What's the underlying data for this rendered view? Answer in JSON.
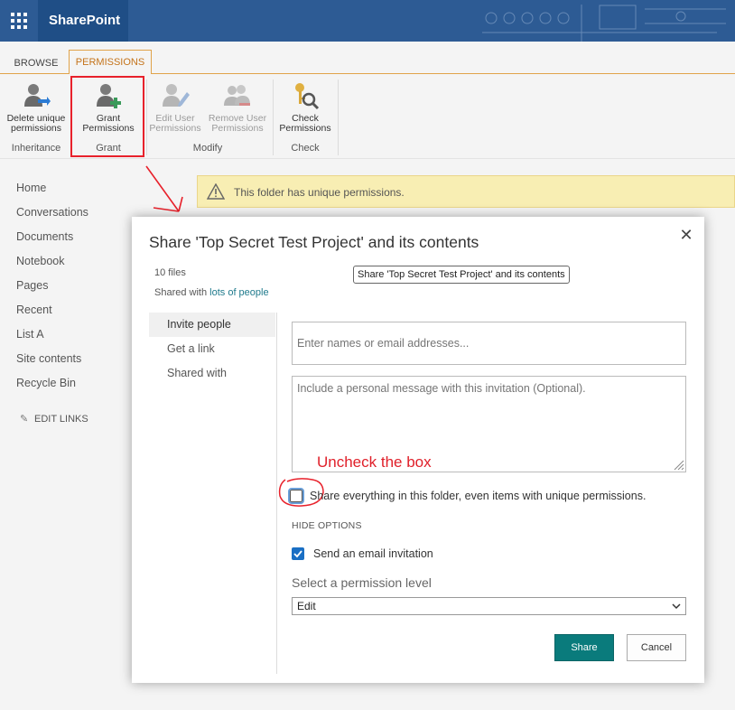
{
  "suite": {
    "brand": "SharePoint"
  },
  "ribbon": {
    "tabs": [
      {
        "label": "BROWSE"
      },
      {
        "label": "PERMISSIONS"
      }
    ],
    "buttons": {
      "delete_unique": {
        "line1": "Delete unique",
        "line2": "permissions"
      },
      "grant": {
        "line1": "Grant",
        "line2": "Permissions"
      },
      "edit_user": {
        "line1": "Edit User",
        "line2": "Permissions"
      },
      "remove_user": {
        "line1": "Remove User",
        "line2": "Permissions"
      },
      "check": {
        "line1": "Check",
        "line2": "Permissions"
      }
    },
    "groups": {
      "inheritance": "Inheritance",
      "grant": "Grant",
      "modify": "Modify",
      "check": "Check"
    }
  },
  "leftnav": {
    "items": [
      "Home",
      "Conversations",
      "Documents",
      "Notebook",
      "Pages",
      "Recent",
      "List A",
      "Site contents",
      "Recycle Bin"
    ],
    "edit_links": "EDIT LINKS"
  },
  "warning": {
    "text": "This folder has unique permissions."
  },
  "dialog": {
    "title": "Share 'Top Secret Test Project' and its contents",
    "tooltip": "Share 'Top Secret Test Project' and its contents",
    "files_count": "10 files",
    "shared_with_prefix": "Shared with",
    "shared_with_link": "lots of people",
    "side_tabs": [
      "Invite people",
      "Get a link",
      "Shared with"
    ],
    "names_placeholder": "Enter names or email addresses...",
    "message_placeholder": "Include a personal message with this invitation (Optional).",
    "share_everything_label": "Share everything in this folder, even items with unique permissions.",
    "hide_options": "HIDE OPTIONS",
    "send_email_label": "Send an email invitation",
    "permission_level_label": "Select a permission level",
    "permission_level_value": "Edit",
    "share_button": "Share",
    "cancel_button": "Cancel"
  },
  "annotation": {
    "text": "Uncheck the box",
    "color": "#e0202a"
  }
}
